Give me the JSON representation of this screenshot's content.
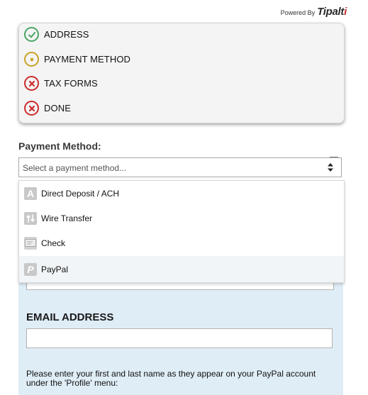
{
  "header": {
    "powered_by": "Powered By",
    "brand_main": "Tipalt",
    "brand_accent": "i"
  },
  "steps": [
    {
      "label": "ADDRESS",
      "status": "complete",
      "icon": "check-circle-icon",
      "color": "#4aa564"
    },
    {
      "label": "PAYMENT METHOD",
      "status": "current",
      "icon": "dot-circle-icon",
      "color": "#c9a227"
    },
    {
      "label": "TAX FORMS",
      "status": "incomplete",
      "icon": "x-circle-icon",
      "color": "#cc2b2b"
    },
    {
      "label": "DONE",
      "status": "incomplete",
      "icon": "x-circle-icon",
      "color": "#cc2b2b"
    }
  ],
  "payment_method": {
    "label": "Payment Method:",
    "placeholder": "Select a payment method...",
    "options": [
      {
        "label": "Direct Deposit / ACH",
        "icon": "letter-a-icon"
      },
      {
        "label": "Wire Transfer",
        "icon": "wire-transfer-icon"
      },
      {
        "label": "Check",
        "icon": "check-bank-icon"
      },
      {
        "label": "PayPal",
        "icon": "paypal-icon",
        "highlighted": true
      }
    ]
  },
  "form": {
    "email_label": "EMAIL ADDRESS",
    "email_value": "",
    "help_text": "Please enter your first and last name as they appear on your PayPal account under the 'Profile' menu:"
  }
}
